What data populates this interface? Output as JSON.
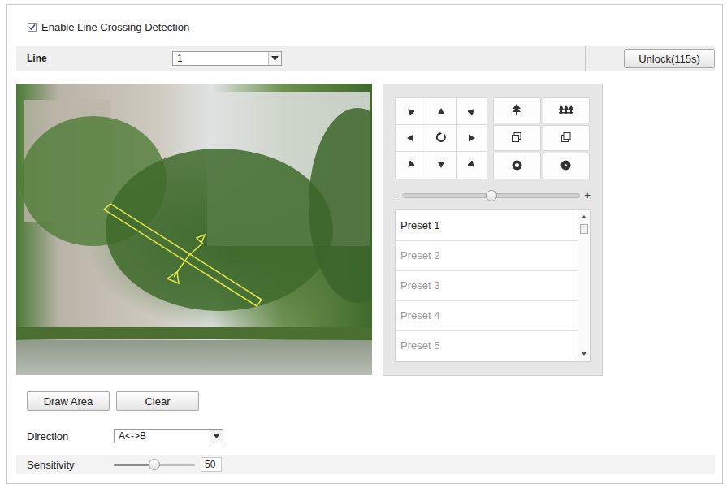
{
  "enable": {
    "label": "Enable Line Crossing Detection",
    "checked": true
  },
  "line": {
    "label": "Line",
    "value": "1"
  },
  "unlock_button": "Unlock(115s)",
  "zoom": {
    "minus": "-",
    "plus": "+",
    "level": 0.5
  },
  "presets": [
    {
      "label": "Preset 1",
      "selected": true,
      "disabled": false
    },
    {
      "label": "Preset 2",
      "selected": false,
      "disabled": true
    },
    {
      "label": "Preset 3",
      "selected": false,
      "disabled": true
    },
    {
      "label": "Preset 4",
      "selected": false,
      "disabled": true
    },
    {
      "label": "Preset 5",
      "selected": false,
      "disabled": true
    }
  ],
  "buttons": [
    "Draw Area",
    "Clear"
  ],
  "direction": {
    "label": "Direction",
    "value": "A<->B"
  },
  "sensitivity": {
    "label": "Sensitivity",
    "level": 0.5,
    "value": "50"
  }
}
